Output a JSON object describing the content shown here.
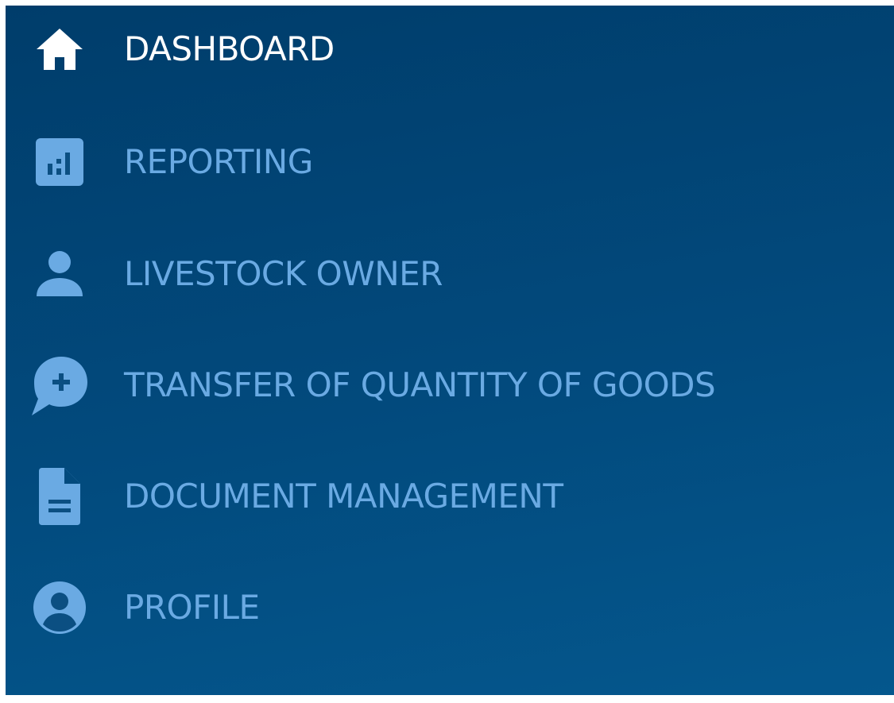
{
  "colors": {
    "active_text": "#ffffff",
    "inactive_text": "#6aaae3",
    "icon": "#6aaae3",
    "background_top": "#003d6b",
    "background_bottom": "#04578d"
  },
  "sidebar": {
    "items": [
      {
        "label": "DASHBOARD",
        "icon": "home-icon",
        "active": true
      },
      {
        "label": "REPORTING",
        "icon": "bar-chart-icon",
        "active": false
      },
      {
        "label": "LIVESTOCK OWNER",
        "icon": "person-icon",
        "active": false
      },
      {
        "label": "TRANSFER OF QUANTITY OF GOODS",
        "icon": "chat-plus-icon",
        "active": false
      },
      {
        "label": "DOCUMENT MANAGEMENT",
        "icon": "document-icon",
        "active": false
      },
      {
        "label": "PROFILE",
        "icon": "account-circle-icon",
        "active": false
      }
    ]
  }
}
